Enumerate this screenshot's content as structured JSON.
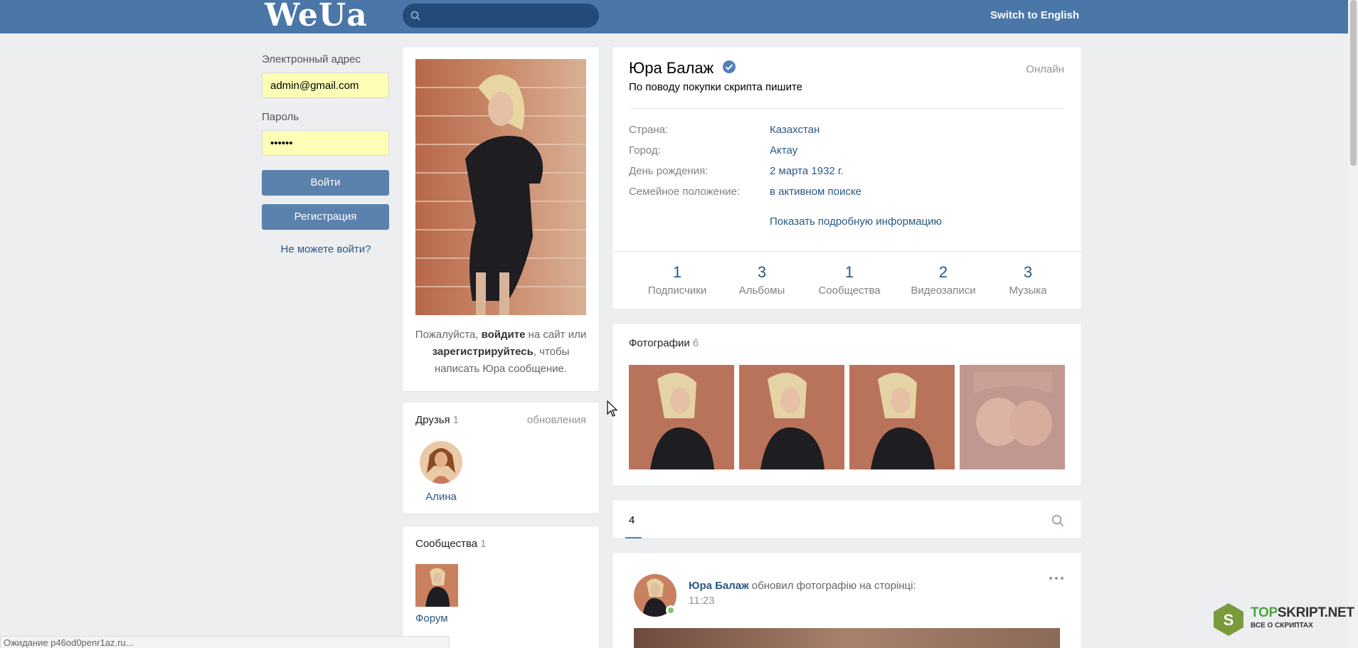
{
  "header": {
    "logo": "WeUa",
    "search_placeholder": "",
    "switch_language": "Switch to English"
  },
  "login": {
    "email_label": "Электронный адрес",
    "email_value": "admin@gmail.com",
    "password_label": "Пароль",
    "password_value": "••••••",
    "login_button": "Войти",
    "register_button": "Регистрация",
    "cant_login": "Не можете войти?"
  },
  "avatar_card": {
    "note_pre": "Пожалуйста, ",
    "note_login": "войдите",
    "note_mid": " на сайт или ",
    "note_register": "зарегистрируйтесь",
    "note_post": ", чтобы написать Юра сообщение."
  },
  "friends": {
    "title": "Друзья",
    "count": "1",
    "updates_link": "обновления",
    "items": [
      {
        "name": "Алина"
      }
    ]
  },
  "communities": {
    "title": "Сообщества",
    "count": "1",
    "items": [
      {
        "name": "Форум"
      }
    ]
  },
  "profile": {
    "name": "Юра Балаж",
    "online": "Онлайн",
    "status": "По поводу покупки скрипта пишите",
    "info": [
      {
        "key": "Страна:",
        "value": "Казахстан"
      },
      {
        "key": "Город:",
        "value": "Актау"
      },
      {
        "key": "День рождения:",
        "value": "2 марта 1932 г."
      },
      {
        "key": "Семейное положение:",
        "value": "в активном поиске"
      }
    ],
    "more_info": "Показать подробную информацию",
    "stats": [
      {
        "num": "1",
        "label": "Подписчики"
      },
      {
        "num": "3",
        "label": "Альбомы"
      },
      {
        "num": "1",
        "label": "Сообщества"
      },
      {
        "num": "2",
        "label": "Видеозаписи"
      },
      {
        "num": "3",
        "label": "Музыка"
      }
    ]
  },
  "photos": {
    "title": "Фотографии",
    "count": "6"
  },
  "wall_tabs": {
    "active_tab": "4"
  },
  "post": {
    "author": "Юра Балаж",
    "action": "обновил фотографію на сторінці:",
    "time": "11:23"
  },
  "statusbar": {
    "text": "Ожидание p46od0penr1az.ru..."
  },
  "watermark": {
    "brand_a": "TOP",
    "brand_b": "SKRIPT.NET",
    "tagline": "ВСЕ О СКРИПТАХ",
    "badge": "S"
  },
  "colors": {
    "header": "#4a76a8",
    "link": "#2a5885",
    "button": "#5b82ad",
    "autofill": "#fdfdb6",
    "page_bg": "#edeef0"
  }
}
